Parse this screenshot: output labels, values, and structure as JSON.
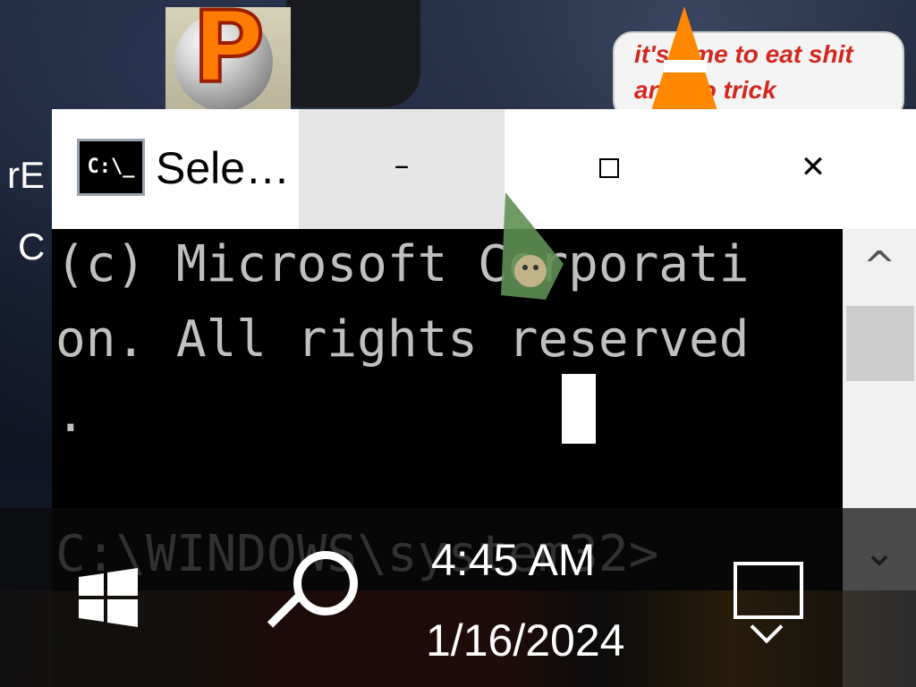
{
  "desktop": {
    "left_label_top": "rE",
    "left_label_bottom": "C",
    "vlc_note_text": "it's time to eat shit and go trick",
    "pinball_letter": "P"
  },
  "window": {
    "title": "Sele…",
    "icon_text": "C:\\_",
    "min_symbol": "–",
    "close_symbol": "✕"
  },
  "console": {
    "lines": [
      "(c) Microsoft Corporati",
      "on. All rights reserved",
      "."
    ],
    "prompt": "C:\\WINDOWS\\system32>"
  },
  "scrollbar": {
    "up_symbol": "^",
    "down_symbol": "⌄"
  },
  "taskbar": {
    "time": "4:45 AM",
    "date": "1/16/2024"
  },
  "colors": {
    "console_bg": "#000000",
    "console_text": "#c0c0c0",
    "titlebar_bg": "#ffffff",
    "vlc_orange": "#ff8800",
    "note_red": "#d1281f"
  }
}
